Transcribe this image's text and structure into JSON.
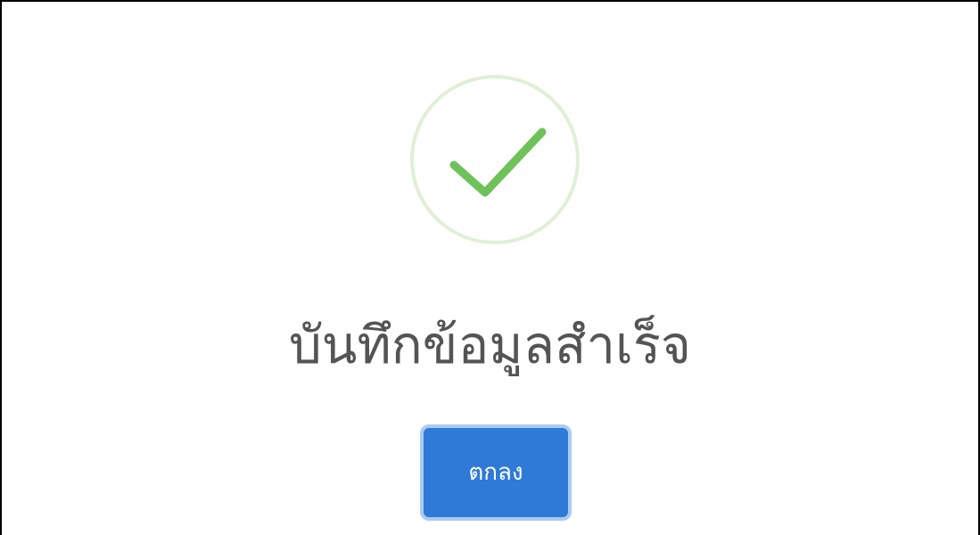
{
  "dialog": {
    "icon": "success-check-icon",
    "title": "บันทึกข้อมูลสำเร็จ",
    "confirm_label": "ตกลง"
  },
  "colors": {
    "check": "#6fc25a",
    "icon_ring": "#dff0d6",
    "title_text": "#545454",
    "button_bg": "#2f7ad6",
    "button_focus_ring": "#aaccf2",
    "button_text": "#ffffff"
  }
}
